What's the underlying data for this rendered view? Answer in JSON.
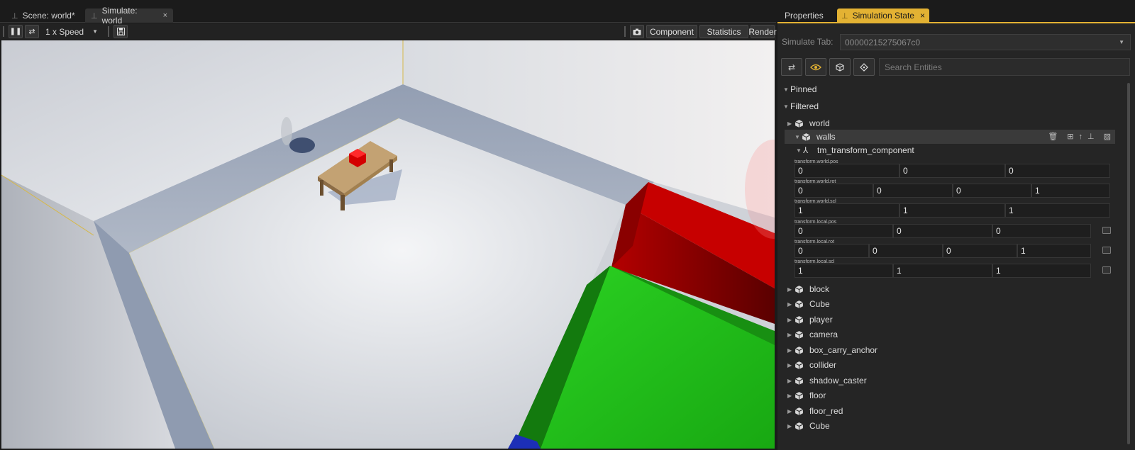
{
  "left_tabs": [
    {
      "label": "Scene: world*"
    },
    {
      "label": "Simulate: world",
      "close": "×"
    }
  ],
  "toolbar": {
    "speed": "1 x Speed",
    "component": "Component",
    "statistics": "Statistics",
    "render": "Render"
  },
  "right_tabs": {
    "properties": "Properties",
    "simulation_state": "Simulation State",
    "close": "×"
  },
  "simulate_tab": {
    "label": "Simulate Tab:",
    "value": "00000215275067c0"
  },
  "search": {
    "placeholder": "Search Entities"
  },
  "tree": {
    "pinned": "Pinned",
    "filtered": "Filtered",
    "world": "world",
    "walls": "walls",
    "component": "tm_transform_component",
    "entities": [
      "block",
      "Cube",
      "player",
      "camera",
      "box_carry_anchor",
      "collider",
      "shadow_caster",
      "floor",
      "floor_red",
      "Cube"
    ]
  },
  "transform": {
    "world_pos": {
      "label": "transform.world.pos",
      "values": [
        "0",
        "0",
        "0"
      ]
    },
    "world_rot": {
      "label": "transform.world.rot",
      "values": [
        "0",
        "0",
        "0",
        "1"
      ]
    },
    "world_scl": {
      "label": "transform.world.scl",
      "values": [
        "1",
        "1",
        "1"
      ]
    },
    "local_pos": {
      "label": "transform.local.pos",
      "values": [
        "0",
        "0",
        "0"
      ]
    },
    "local_rot": {
      "label": "transform.local.rot",
      "values": [
        "0",
        "0",
        "0",
        "1"
      ]
    },
    "local_scl": {
      "label": "transform.local.scl",
      "values": [
        "1",
        "1",
        "1"
      ]
    }
  },
  "colors": {
    "accent": "#e3b233",
    "panel": "#252525",
    "red_block": "#c80000",
    "green_block": "#22c81a"
  },
  "icons": [
    "pin-icon",
    "pause-icon",
    "loop-icon",
    "save-icon",
    "camera-icon",
    "eye-icon",
    "cube-icon",
    "target-icon",
    "trash-icon",
    "hierarchy-icon",
    "arrow-up-icon",
    "image-icon"
  ]
}
